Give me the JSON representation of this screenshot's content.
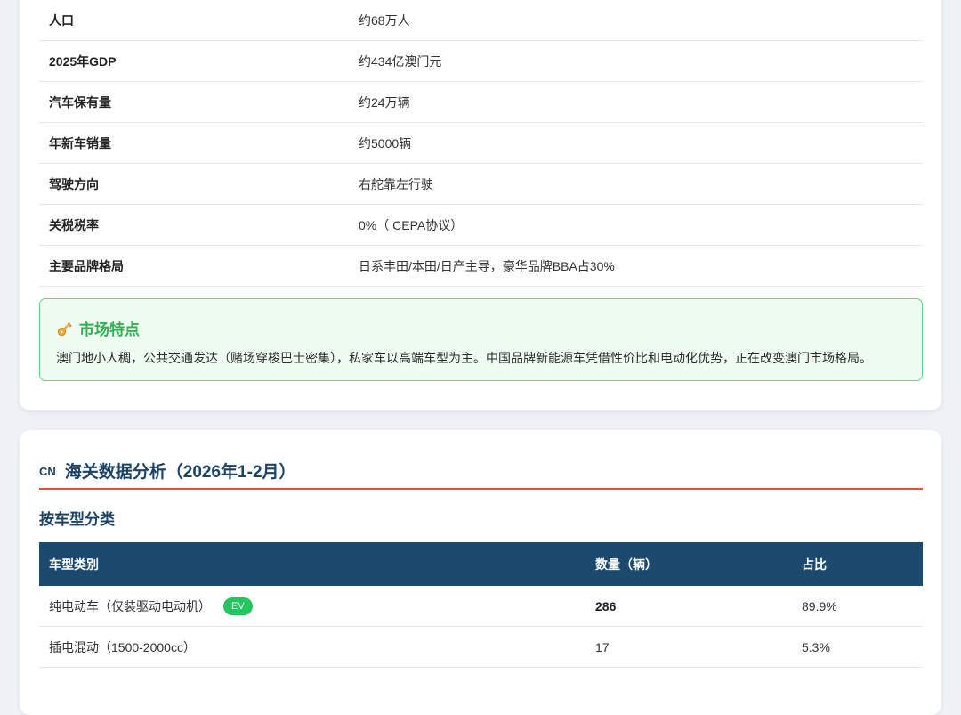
{
  "info_rows": [
    {
      "key": "人口",
      "value": "约68万人"
    },
    {
      "key": "2025年GDP",
      "value": "约434亿澳门元"
    },
    {
      "key": "汽车保有量",
      "value": "约24万辆"
    },
    {
      "key": "年新车销量",
      "value": "约5000辆"
    },
    {
      "key": "驾驶方向",
      "value": "右舵靠左行驶"
    },
    {
      "key": "关税税率",
      "value": "0%（ CEPA协议）"
    },
    {
      "key": "主要品牌格局",
      "value": "日系丰田/本田/日产主导，豪华品牌BBA占30%"
    }
  ],
  "feature": {
    "icon": "key-icon",
    "title": "市场特点",
    "text": "澳门地小人稠，公共交通发达（赌场穿梭巴士密集），私家车以高端车型为主。中国品牌新能源车凭借性价比和电动化优势，正在改变澳门市场格局。"
  },
  "customs": {
    "flag": "CN",
    "title": "海关数据分析（2026年1-2月）",
    "subtitle": "按车型分类",
    "headers": [
      "车型类别",
      "数量（辆）",
      "占比"
    ],
    "rows": [
      {
        "type": "纯电动车（仅装驱动电动机）",
        "badge": "EV",
        "count": "286",
        "share": "89.9%"
      },
      {
        "type": "插电混动（1500-2000cc）",
        "badge": "",
        "count": "17",
        "share": "5.3%"
      }
    ]
  },
  "colors": {
    "accent_navy": "#1c4a6e",
    "divider_red": "#e0533f",
    "feature_green": "#2fb24f",
    "badge_green": "#22c55e"
  }
}
